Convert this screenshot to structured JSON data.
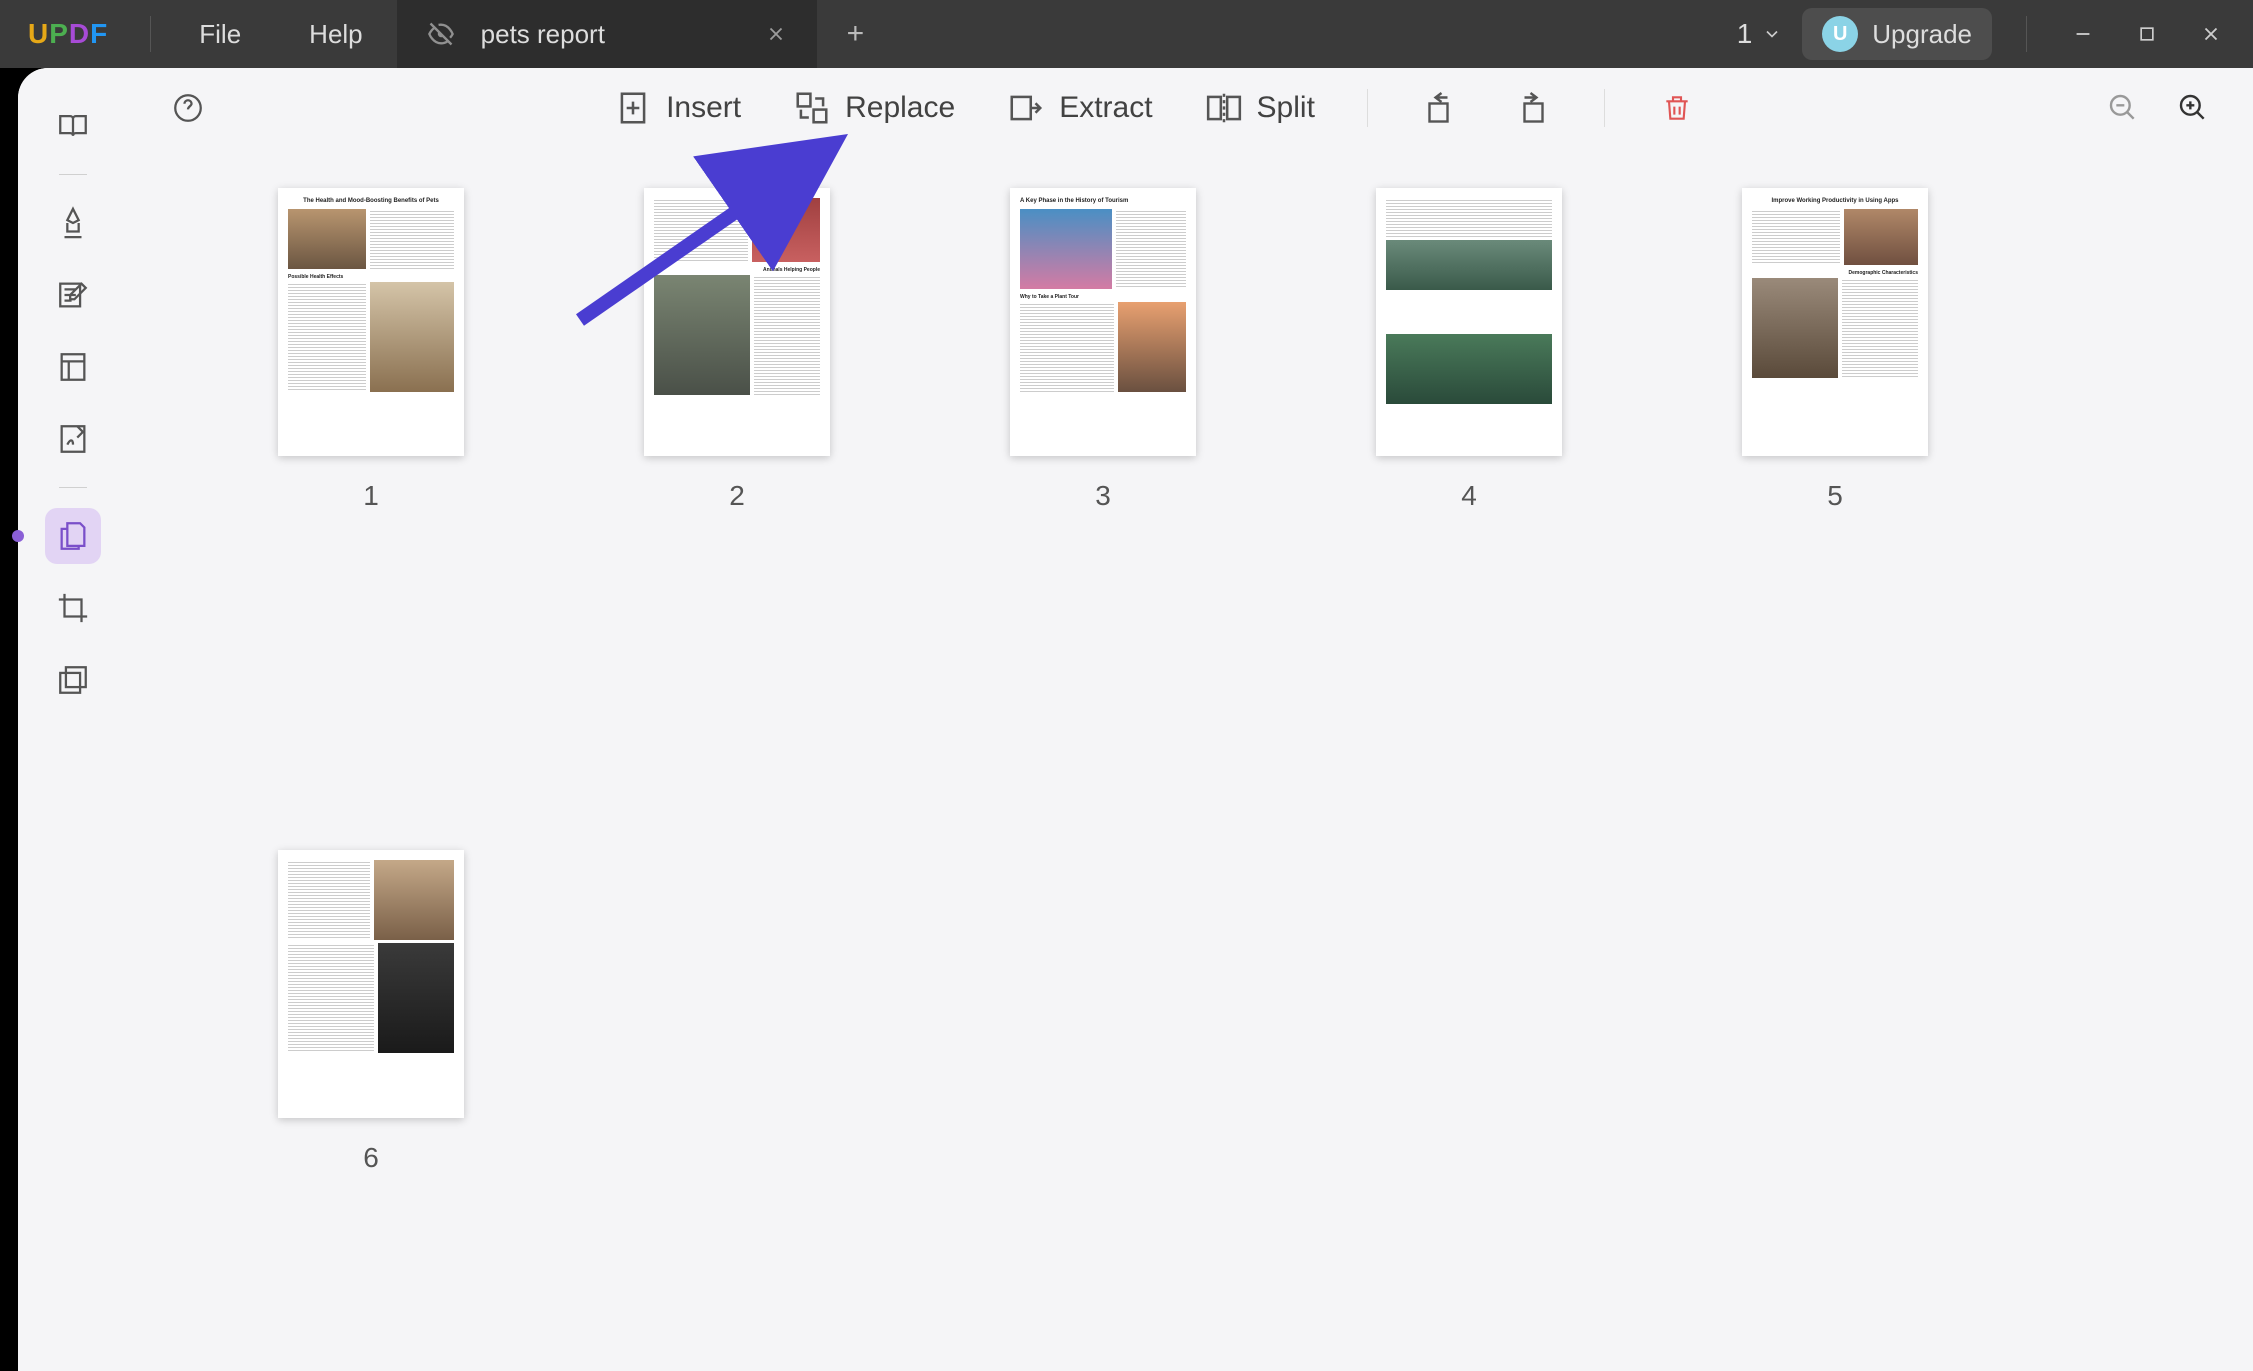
{
  "app_name": "UPDF",
  "titlebar": {
    "menus": [
      "File",
      "Help"
    ],
    "tab": {
      "label": "pets report"
    },
    "page_indicator": "1",
    "upgrade_label": "Upgrade",
    "avatar_initial": "U"
  },
  "toolbar": {
    "insert": "Insert",
    "replace": "Replace",
    "extract": "Extract",
    "split": "Split"
  },
  "pages": [
    {
      "number": "1",
      "title": "The Health and Mood-Boosting Benefits of Pets",
      "sub": "Possible Health Effects"
    },
    {
      "number": "2",
      "title": "",
      "sub": "Animals Helping People"
    },
    {
      "number": "3",
      "title": "A Key Phase in the History of Tourism",
      "sub": "Why to Take a Plant Tour"
    },
    {
      "number": "4",
      "title": "",
      "sub": ""
    },
    {
      "number": "5",
      "title": "Improve Working Productivity in Using Apps",
      "sub": "Demographic Characteristics"
    },
    {
      "number": "6",
      "title": "",
      "sub": ""
    }
  ],
  "colors": {
    "accent": "#8a5fd6",
    "arrow": "#4a3dd1"
  }
}
